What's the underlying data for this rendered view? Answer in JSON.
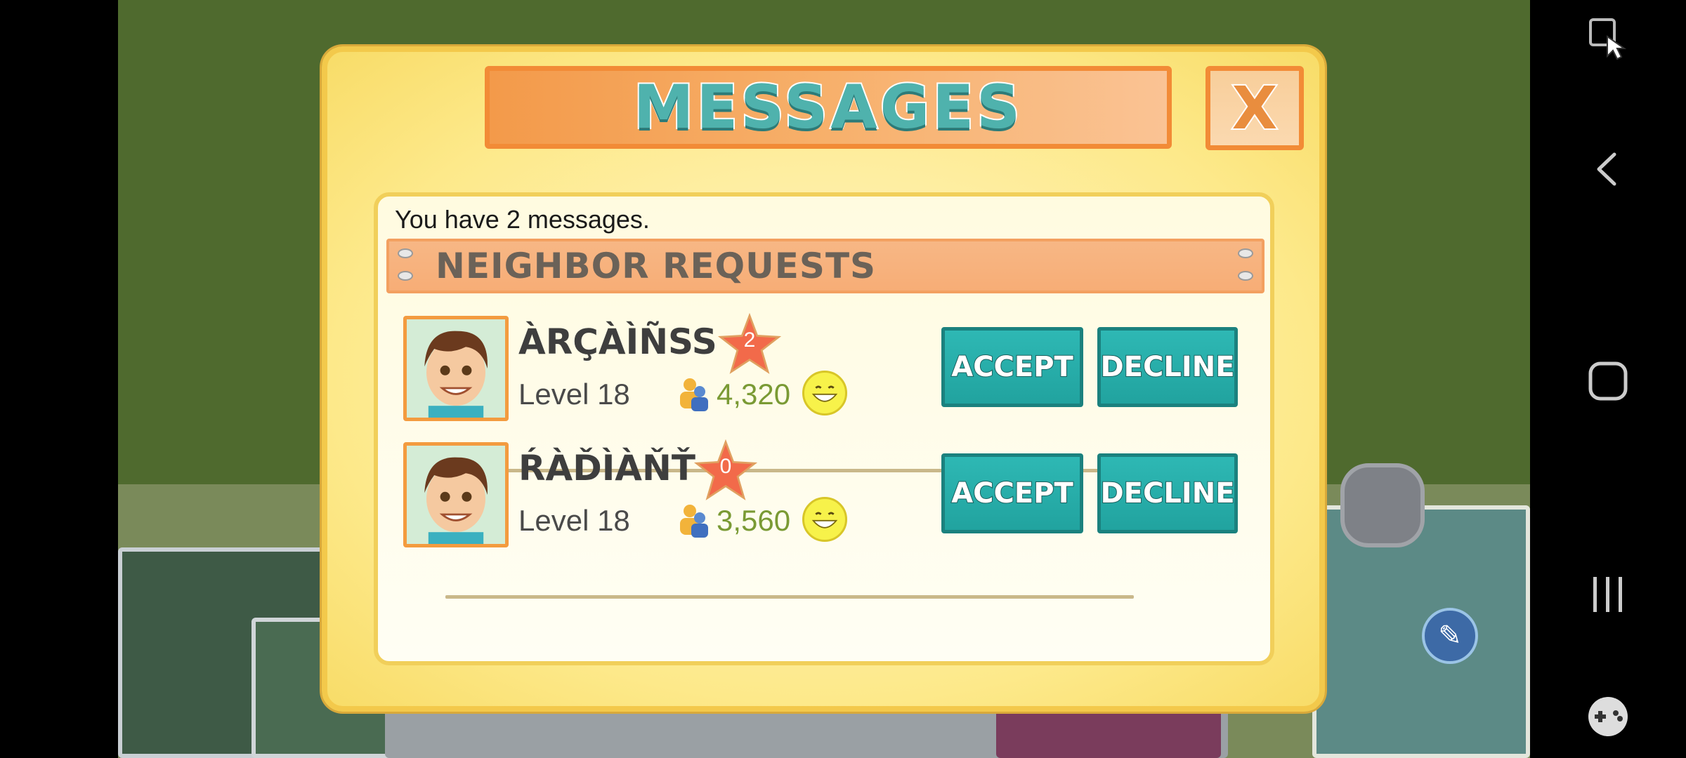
{
  "dialog": {
    "title": "MESSAGES",
    "close_label": "X",
    "message_count_text": "You have 2 messages.",
    "section_title": "NEIGHBOR REQUESTS",
    "requests": [
      {
        "name": "ÀRÇÀÌÑSS",
        "star_count": "2",
        "level": "Level 18",
        "population": "4,320",
        "accept_label": "ACCEPT",
        "decline_label": "DECLINE"
      },
      {
        "name": "ŔÀĎÌÀŇŤ",
        "star_count": "0",
        "level": "Level 18",
        "population": "3,560",
        "accept_label": "ACCEPT",
        "decline_label": "DECLINE"
      }
    ]
  },
  "icons": {
    "close": "close-icon",
    "population": "population-icon",
    "happiness": "smile-icon",
    "star": "star-icon",
    "avatar": "avatar-icon",
    "map_edit": "pencil-icon",
    "nav": [
      "screen-capture-icon",
      "back-icon",
      "home-icon",
      "recents-icon",
      "game-tools-icon"
    ]
  },
  "colors": {
    "title_teal": "#4fb2ad",
    "button_teal": "#2eb8b4",
    "frame_orange": "#f28b36",
    "dialog_yellow": "#fde98a",
    "population_green": "#7a9a34"
  }
}
